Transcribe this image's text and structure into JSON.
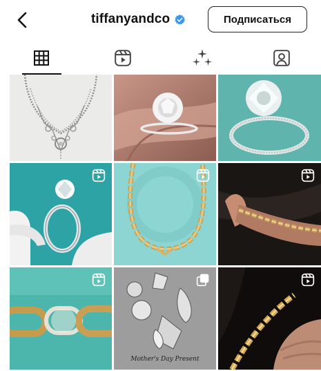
{
  "header": {
    "username": "tiffanyandco",
    "subscribe_label": "Подписаться",
    "verified_color": "#3897f0"
  },
  "tabs": [
    {
      "name": "posts-grid",
      "icon": "grid-icon",
      "active": true
    },
    {
      "name": "reels",
      "icon": "reels-icon",
      "active": false
    },
    {
      "name": "effects",
      "icon": "sparkles-icon",
      "active": false
    },
    {
      "name": "tagged",
      "icon": "tagged-person-icon",
      "active": false
    }
  ],
  "grid": {
    "posts": [
      {
        "subject": "diamond necklace",
        "badge": "none"
      },
      {
        "subject": "engagement ring on hand",
        "badge": "none"
      },
      {
        "subject": "diamond ring",
        "badge": "none"
      },
      {
        "subject": "ring held by gloved fingers",
        "badge": "reels-icon"
      },
      {
        "subject": "gold chain necklace",
        "badge": "reels-icon"
      },
      {
        "subject": "chain bracelet on hand",
        "badge": "reels-icon"
      },
      {
        "subject": "pave link bracelet",
        "badge": "reels-icon"
      },
      {
        "subject": "brooches",
        "badge": "carousel-icon",
        "caption": "Mother's Day Present"
      },
      {
        "subject": "gold chain in hand",
        "badge": "reels-icon"
      }
    ]
  },
  "colors": {
    "tiffany_blue": "#81d8d0",
    "accent_dark": "#111111"
  }
}
